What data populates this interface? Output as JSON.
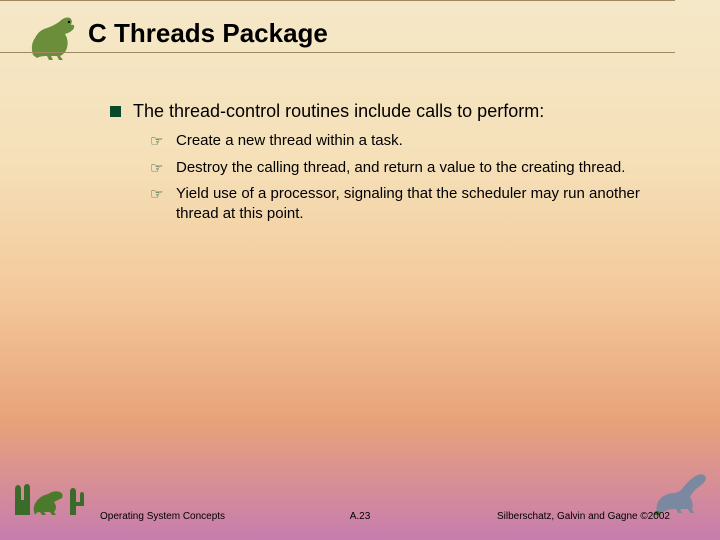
{
  "title": "C Threads Package",
  "main_bullet": "The thread-control routines include calls to perform:",
  "sub_bullets": [
    "Create a new thread within a task.",
    "Destroy the calling thread, and return a value to the creating thread.",
    "Yield use of a processor, signaling that the scheduler may run another thread at this point."
  ],
  "footer": {
    "left": "Operating System Concepts",
    "center": "A.23",
    "right": "Silberschatz, Galvin and Gagne ©2002"
  }
}
